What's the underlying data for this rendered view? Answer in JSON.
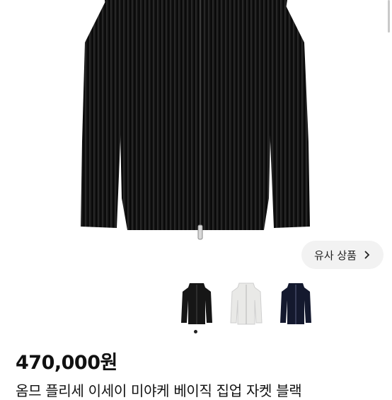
{
  "similar_button": {
    "label": "유사 상품",
    "icon": "chevron-right-icon"
  },
  "thumbnails": [
    {
      "name": "black",
      "color": "#161616"
    },
    {
      "name": "white",
      "color": "#e9e9e7"
    },
    {
      "name": "navy",
      "color": "#14192e"
    }
  ],
  "carousel": {
    "active_index": 0
  },
  "product": {
    "price": "470,000원",
    "title": "옴므 플리세 이세이 미야케 베이직 집업 자켓 블랙"
  },
  "colors": {
    "jacket": "#121212",
    "accent": "#222222"
  }
}
